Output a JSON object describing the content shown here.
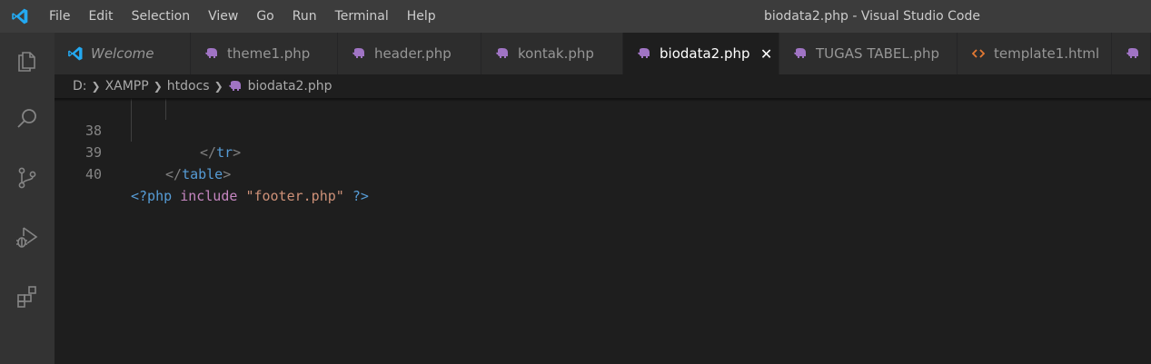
{
  "window": {
    "title": "biodata2.php - Visual Studio Code"
  },
  "menu": [
    "File",
    "Edit",
    "Selection",
    "View",
    "Go",
    "Run",
    "Terminal",
    "Help"
  ],
  "activity_bar": [
    "explorer-icon",
    "search-icon",
    "source-control-icon",
    "run-debug-icon",
    "extensions-icon"
  ],
  "tabs": [
    {
      "label": "Welcome",
      "icon": "vscode-logo-icon",
      "active": false
    },
    {
      "label": "theme1.php",
      "icon": "php-elephant-icon",
      "active": false
    },
    {
      "label": "header.php",
      "icon": "php-elephant-icon",
      "active": false
    },
    {
      "label": "kontak.php",
      "icon": "php-elephant-icon",
      "active": false
    },
    {
      "label": "biodata2.php",
      "icon": "php-elephant-icon",
      "active": true
    },
    {
      "label": "TUGAS TABEL.php",
      "icon": "php-elephant-icon",
      "active": false
    },
    {
      "label": "template1.html",
      "icon": "html-brackets-icon",
      "active": false
    }
  ],
  "breadcrumb": [
    "D:",
    "XAMPP",
    "htdocs",
    "biodata2.php"
  ],
  "editor": {
    "lines": [
      {
        "number": "38",
        "open": "</",
        "tag": "tr",
        "close": ">"
      },
      {
        "number": "39",
        "open": "</",
        "tag": "table",
        "close": ">"
      },
      {
        "number": "40",
        "php_open": "<?php",
        "keyword": "include",
        "string": "\"footer.php\"",
        "php_close": "?>"
      }
    ]
  },
  "colors": {
    "accent": "#0098ff",
    "php_icon": "#a074c4",
    "html_icon": "#e37933",
    "tag": "#569cd6",
    "keyword": "#c586c0",
    "string": "#ce9178"
  }
}
